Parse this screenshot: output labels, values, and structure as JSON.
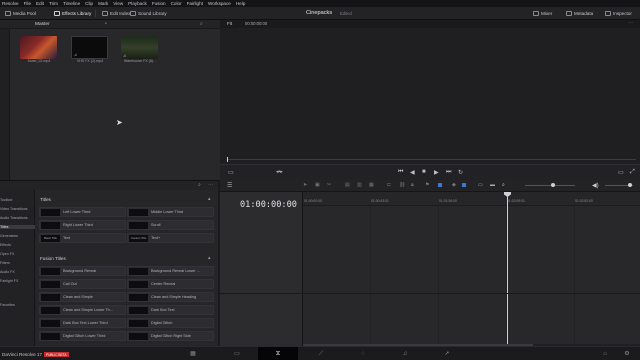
{
  "menu": [
    "Resolve",
    "File",
    "Edit",
    "Trim",
    "Timeline",
    "Clip",
    "Mark",
    "View",
    "Playback",
    "Fusion",
    "Color",
    "Fairlight",
    "Workspace",
    "Help"
  ],
  "toolbar": {
    "media_pool": "Media Pool",
    "effects_library": "Effects Library",
    "edit_index": "Edit Index",
    "sound_library": "Sound Library",
    "project_title": "Cinepacks",
    "project_status": "Edited",
    "mixer": "Mixer",
    "metadata": "Metadata",
    "inspector": "Inspector"
  },
  "media_pool": {
    "bin_label": "Master",
    "clips": [
      {
        "name": "Motel_02.mp4"
      },
      {
        "name": "VHS FX (2).mp4"
      },
      {
        "name": "Warehouse FX (8)..."
      }
    ]
  },
  "viewer": {
    "fit_label": "Fit",
    "timecode": "00:00:00:00"
  },
  "effects": {
    "tree": [
      "Toolbox",
      "Video Transitions",
      "Audio Transitions",
      "Titles",
      "Generators",
      "Effects",
      "Open FX",
      "Filters",
      "Audio FX",
      "Fairlight FX",
      "Favorites"
    ],
    "titles_section": "Titles",
    "titles": [
      {
        "label": "Left Lower Third",
        "thumb": ""
      },
      {
        "label": "Middle Lower Third",
        "thumb": ""
      },
      {
        "label": "Right Lower Third",
        "thumb": ""
      },
      {
        "label": "Scroll",
        "thumb": ""
      },
      {
        "label": "Text",
        "thumb": "Basic Title"
      },
      {
        "label": "Text+",
        "thumb": "Custom Title"
      }
    ],
    "fusion_section": "Fusion Titles",
    "fusion_titles": [
      {
        "label": "Background Reveal"
      },
      {
        "label": "Background Reveal Lower ..."
      },
      {
        "label": "Call Out"
      },
      {
        "label": "Center Reveal"
      },
      {
        "label": "Clean and Simple"
      },
      {
        "label": "Clean and Simple Heading"
      },
      {
        "label": "Clean and Simple Lower Th..."
      },
      {
        "label": "Dark Box Text"
      },
      {
        "label": "Dark Box Text Lower Third"
      },
      {
        "label": "Digital Glitch"
      },
      {
        "label": "Digital Glitch Lower Third"
      },
      {
        "label": "Digital Glitch Right Side"
      }
    ]
  },
  "timeline": {
    "timecode": "01:00:00:00",
    "ruler": [
      "01:00:00:00",
      "01:00:43:01",
      "01:01:26:00",
      "01:02:09:01",
      "01:02:52:00"
    ]
  },
  "app": {
    "name": "DaVinci Resolve 17",
    "badge": "PUBLIC BETA"
  },
  "colors": {
    "accent_blue": "#3a7bd5",
    "beta_red": "#c22e2e",
    "playhead": "#cfcfd4"
  }
}
